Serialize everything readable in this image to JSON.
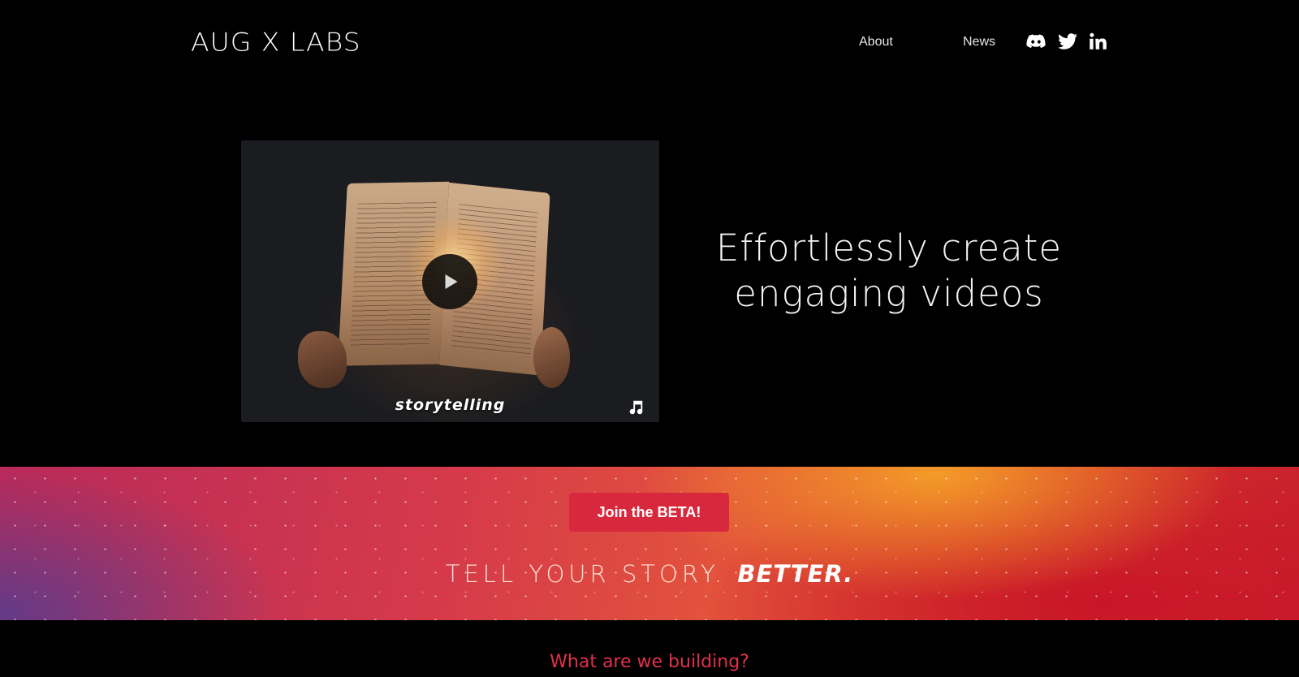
{
  "header": {
    "logo": "AUG X LABS",
    "nav": [
      {
        "label": "About"
      },
      {
        "label": "News"
      }
    ],
    "social": [
      "discord-icon",
      "twitter-icon",
      "linkedin-icon"
    ]
  },
  "hero": {
    "video_caption": "storytelling",
    "headline_line1": "Effortlessly create",
    "headline_line2": "engaging videos"
  },
  "banner": {
    "cta_label": "Join the BETA!",
    "tagline_part1": "TELL YOUR STORY. ",
    "tagline_part2": "BETTER."
  },
  "section": {
    "heading": "What are we building?"
  },
  "colors": {
    "background": "#000000",
    "cta": "#d8283d",
    "heading_accent": "#e0314a"
  }
}
